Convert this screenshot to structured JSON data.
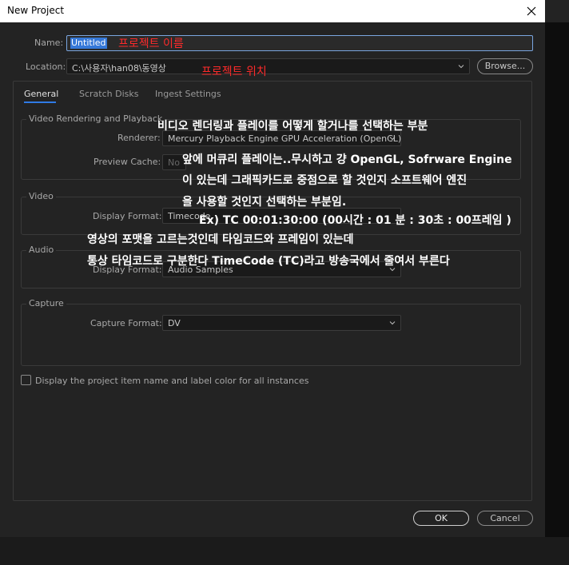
{
  "window": {
    "title": "New Project"
  },
  "name": {
    "label": "Name:",
    "value": "Untitled"
  },
  "location": {
    "label": "Location:",
    "value": "C:\\사용자\\han08\\동영상",
    "browse_label": "Browse..."
  },
  "tabs": [
    {
      "label": "General",
      "active": true
    },
    {
      "label": "Scratch Disks",
      "active": false
    },
    {
      "label": "Ingest Settings",
      "active": false
    }
  ],
  "video_rendering": {
    "header": "Video Rendering and Playback",
    "renderer_label": "Renderer:",
    "renderer_value": "Mercury Playback Engine GPU Acceleration (OpenCL)",
    "preview_cache_label": "Preview Cache:",
    "preview_cache_value": "No"
  },
  "video": {
    "header": "Video",
    "display_format_label": "Display Format:",
    "display_format_value": "Timecode"
  },
  "audio": {
    "header": "Audio",
    "display_format_label": "Display Format:",
    "display_format_value": "Audio Samples"
  },
  "capture": {
    "header": "Capture",
    "capture_format_label": "Capture Format:",
    "capture_format_value": "DV"
  },
  "checkbox": {
    "label": "Display the project item name and label color for all instances",
    "checked": false
  },
  "buttons": {
    "ok": "OK",
    "cancel": "Cancel"
  },
  "annotations": {
    "name": "프로젝트 이름",
    "location": "프로젝트 위치",
    "renderer_1": "비디오 렌더링과 플레이를 어떻게 할거나를 선택하는 부분",
    "renderer_2": "앞에 머큐리 플레이는..무시하고 걍 OpenGL, Sofrware Engine",
    "renderer_3": "이 있는데 그래픽카드로 중점으로 할 것인지 소프트웨어 엔진",
    "renderer_4": "을 사용할 것인지 선택하는 부분임.",
    "timecode_example": "Ex) TC 00:01:30:00  (00시간 : 01 분 : 30초 : 00프레임 )",
    "format_1": "영상의 포맷을 고르는것인데 타임코드와 프레임이 있는데",
    "format_2": "통상 타임코드로 구분한다 TimeCode (TC)라고 방송국에서 줄여서 부른다"
  },
  "colors": {
    "accent": "#2f7ae5",
    "annotation_red": "#ff2a2a",
    "annotation_white": "#ffffff"
  },
  "icons": {
    "close": "close-icon",
    "dropdown": "chevron-down-icon"
  }
}
